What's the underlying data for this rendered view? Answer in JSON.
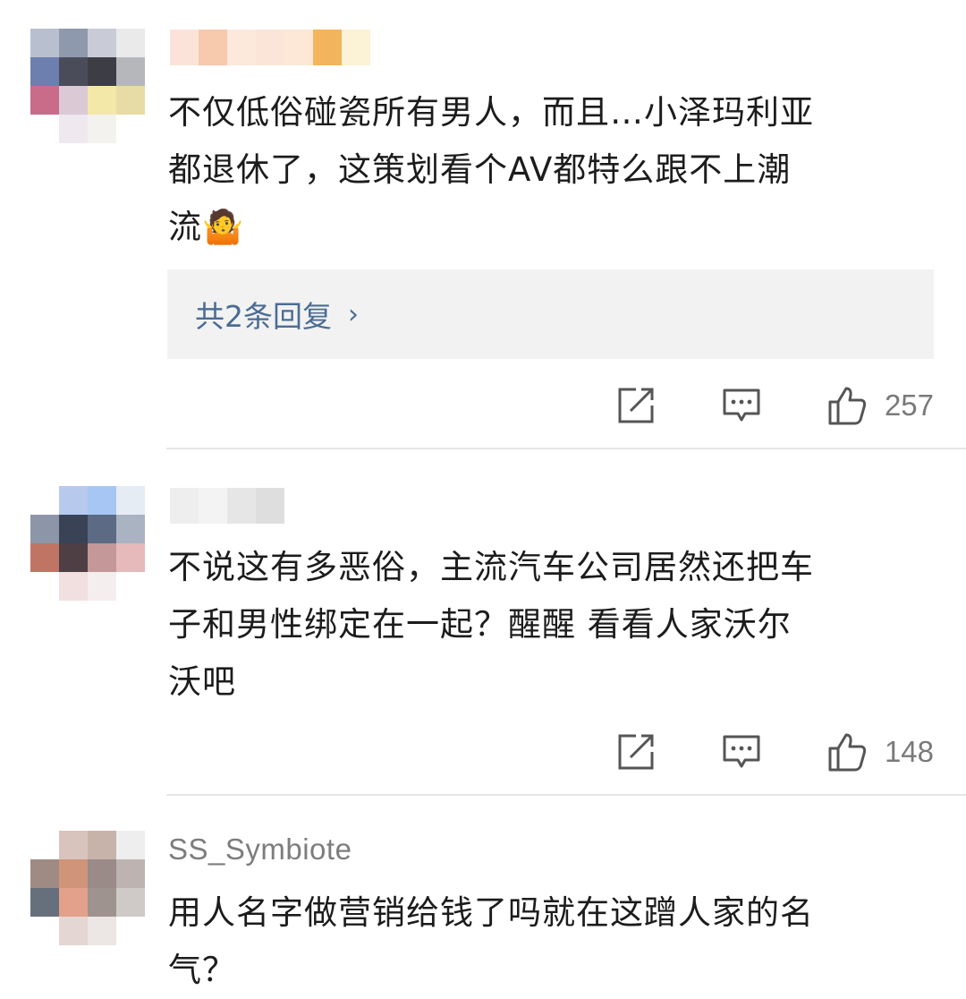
{
  "comments": [
    {
      "username": "",
      "text": "不仅低俗碰瓷所有男人，而且…小泽玛利亚都退休了，这策划看个AV都特么跟不上潮流🤷",
      "lines": [
        "不仅低俗碰瓷所有男人，而且…小泽玛利亚",
        "都退休了，这策划看个AV都特么跟不上潮",
        "流🤷"
      ],
      "reply_label": "共2条回复",
      "reply_chevron": "›",
      "likes": "257",
      "icons": [
        "share-icon",
        "comment-icon",
        "like-icon"
      ]
    },
    {
      "username": "",
      "text": "不说这有多恶俗，主流汽车公司居然还把车子和男性绑定在一起？醒醒 看看人家沃尔沃吧",
      "lines": [
        "不说这有多恶俗，主流汽车公司居然还把车",
        "子和男性绑定在一起？醒醒 看看人家沃尔",
        "沃吧"
      ],
      "likes": "148",
      "icons": [
        "share-icon",
        "comment-icon",
        "like-icon"
      ]
    },
    {
      "username": "SS_Symbiote",
      "text": "用人名字做营销给钱了吗就在这蹭人家的名气？",
      "lines": [
        "用人名字做营销给钱了吗就在这蹭人家的名",
        "气？"
      ]
    }
  ],
  "colors": {
    "link": "#4a6c94",
    "reply_bg": "#f2f2f2",
    "meta_text": "#7a7a7a",
    "divider": "#e6e6e6"
  }
}
